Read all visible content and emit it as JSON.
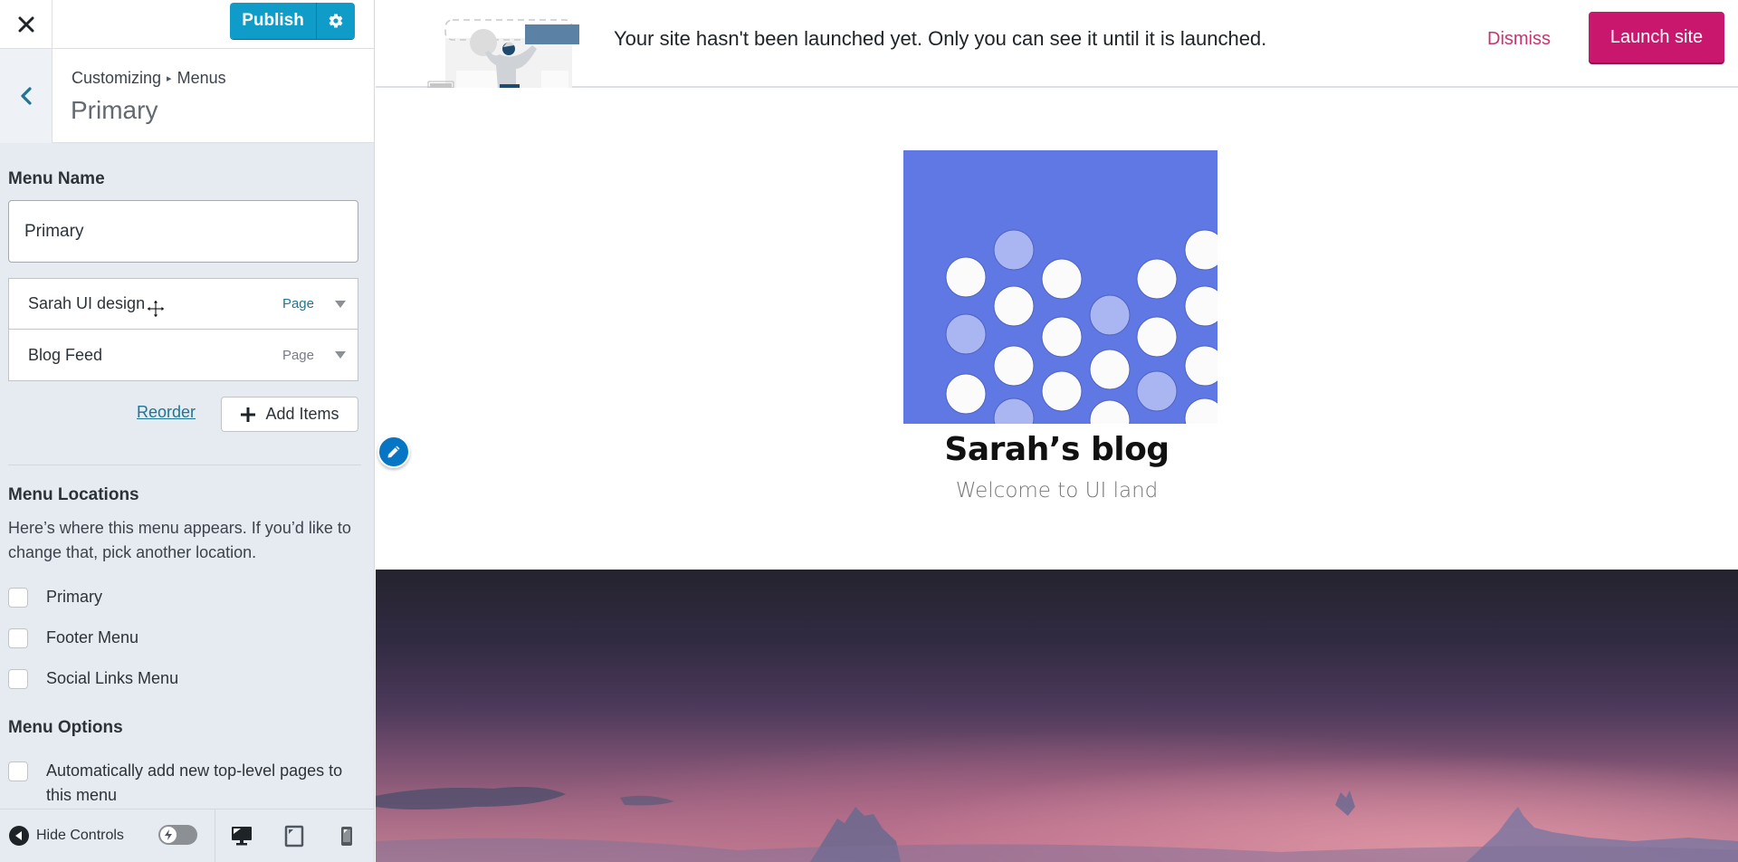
{
  "sidebar": {
    "header": {
      "close_label": "Close",
      "publish_label": "Publish",
      "publish_settings_label": "Publish settings"
    },
    "section": {
      "breadcrumb_root": "Customizing",
      "breadcrumb_separator": "▸",
      "breadcrumb_current": "Menus",
      "title": "Primary",
      "back_label": "Back"
    },
    "menu_name": {
      "label": "Menu Name",
      "value": "Primary"
    },
    "menu_items": [
      {
        "title": "Sarah UI design",
        "type": "Page"
      },
      {
        "title": "Blog Feed",
        "type": "Page"
      }
    ],
    "reorder_label": "Reorder",
    "add_items_label": "Add Items",
    "menu_locations": {
      "heading": "Menu Locations",
      "description": "Here’s where this menu appears. If you’d like to change that, pick another location.",
      "options": [
        {
          "label": "Primary",
          "checked": false
        },
        {
          "label": "Footer Menu",
          "checked": false
        },
        {
          "label": "Social Links Menu",
          "checked": false
        }
      ]
    },
    "menu_options": {
      "heading": "Menu Options",
      "auto_add_label": "Automatically add new top-level pages to this menu",
      "auto_add_checked": false
    },
    "footer": {
      "hide_controls_label": "Hide Controls",
      "devices": [
        "desktop",
        "tablet",
        "mobile"
      ],
      "active_device": "desktop"
    }
  },
  "banner": {
    "message": "Your site hasn't been launched yet. Only you can see it until it is launched.",
    "dismiss_label": "Dismiss",
    "launch_label": "Launch site"
  },
  "site": {
    "title": "Sarah’s blog",
    "tagline": "Welcome to UI land"
  },
  "colors": {
    "publish_blue": "#109cc9",
    "launch_pink": "#c9176e",
    "link_teal": "#1e7594",
    "logo_blue": "#6078e3",
    "sidebar_bg": "#e6ebf2"
  }
}
